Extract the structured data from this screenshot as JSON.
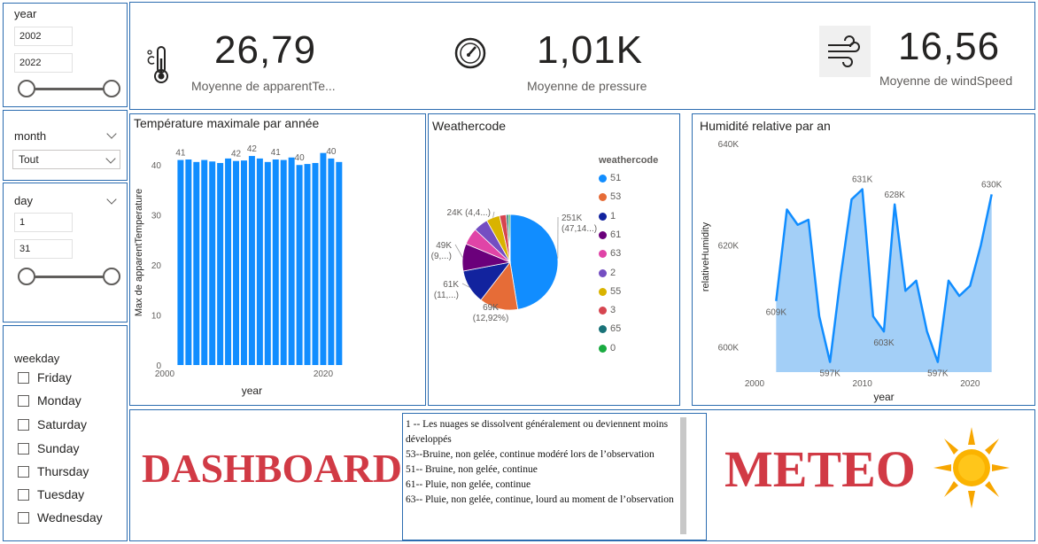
{
  "filters": {
    "year": {
      "label": "year",
      "from": "2002",
      "to": "2022"
    },
    "month": {
      "label": "month",
      "selected": "Tout"
    },
    "day": {
      "label": "day",
      "from": "1",
      "to": "31"
    },
    "weekday": {
      "label": "weekday",
      "options": [
        "Friday",
        "Monday",
        "Saturday",
        "Sunday",
        "Thursday",
        "Tuesday",
        "Wednesday"
      ]
    }
  },
  "kpis": [
    {
      "icon": "thermometer-icon",
      "value": "26,79",
      "label": "Moyenne de apparentTe..."
    },
    {
      "icon": "pressure-gauge-icon",
      "value": "1,01K",
      "label": "Moyenne de pressure"
    },
    {
      "icon": "wind-icon",
      "value": "16,56",
      "label": "Moyenne de windSpeed"
    }
  ],
  "cards": {
    "temp": {
      "title": "Température maximale par année"
    },
    "weather": {
      "title": "Weathercode"
    },
    "humidity": {
      "title": "Humidité relative par an"
    }
  },
  "chart_data": [
    {
      "type": "bar",
      "title": "Température maximale par année",
      "xlabel": "year",
      "ylabel": "Max de apparentTemperature",
      "categories": [
        2002,
        2003,
        2004,
        2005,
        2006,
        2007,
        2008,
        2009,
        2010,
        2011,
        2012,
        2013,
        2014,
        2015,
        2016,
        2017,
        2018,
        2019,
        2020,
        2021,
        2022
      ],
      "values": [
        41,
        41.1,
        40.6,
        41,
        40.7,
        40.4,
        41.3,
        40.8,
        40.9,
        41.8,
        41.3,
        40.6,
        41.1,
        41,
        41.5,
        40,
        40.2,
        40.4,
        42.4,
        41.3,
        40.6
      ],
      "data_labels": [
        {
          "x": 2002,
          "text": "41"
        },
        {
          "x": 2009,
          "text": "42"
        },
        {
          "x": 2011,
          "text": "42"
        },
        {
          "x": 2014,
          "text": "41"
        },
        {
          "x": 2017,
          "text": "40"
        },
        {
          "x": 2021,
          "text": "40"
        }
      ],
      "ylim": [
        0,
        45
      ],
      "yticks": [
        0,
        10,
        20,
        30,
        40
      ],
      "xticks": [
        2000,
        2020
      ],
      "color": "#118dff"
    },
    {
      "type": "pie",
      "title": "Weathercode",
      "legend_title": "weathercode",
      "legend_position": "right",
      "slices": [
        {
          "name": "51",
          "value": 251,
          "color": "#118dff",
          "label": [
            "251K",
            "(47,14...)"
          ]
        },
        {
          "name": "53",
          "value": 69,
          "color": "#e66c37",
          "label": [
            "69K",
            "(12,92%)"
          ]
        },
        {
          "name": "1",
          "value": 61,
          "color": "#12239e",
          "label": [
            "61K",
            "(11,...)"
          ]
        },
        {
          "name": "61",
          "value": 49,
          "color": "#6b007b",
          "label": [
            "49K",
            "(9,...)"
          ]
        },
        {
          "name": "63",
          "value": 30,
          "color": "#e044a7",
          "label": []
        },
        {
          "name": "2",
          "value": 26,
          "color": "#744ec2",
          "label": []
        },
        {
          "name": "55",
          "value": 24,
          "color": "#d9b300",
          "label": [
            "24K (4,4...)"
          ]
        },
        {
          "name": "3",
          "value": 12,
          "color": "#d64550",
          "label": []
        },
        {
          "name": "65",
          "value": 4,
          "color": "#197278",
          "label": []
        },
        {
          "name": "0",
          "value": 3,
          "color": "#1aab40",
          "label": []
        }
      ]
    },
    {
      "type": "area",
      "title": "Humidité relative par an",
      "xlabel": "year",
      "ylabel": "relativeHumidity",
      "x": [
        2002,
        2003,
        2004,
        2005,
        2006,
        2007,
        2008,
        2009,
        2010,
        2011,
        2012,
        2013,
        2014,
        2015,
        2016,
        2017,
        2018,
        2019,
        2020,
        2021,
        2022
      ],
      "values": [
        609,
        627,
        624,
        625,
        606,
        597,
        614,
        629,
        631,
        606,
        603,
        628,
        611,
        613,
        603,
        597,
        613,
        610,
        612,
        620,
        630
      ],
      "data_labels": [
        {
          "x": 2002,
          "text": "609K",
          "pos": "below"
        },
        {
          "x": 2007,
          "text": "597K",
          "pos": "below"
        },
        {
          "x": 2010,
          "text": "631K",
          "pos": "above"
        },
        {
          "x": 2012,
          "text": "603K",
          "pos": "below"
        },
        {
          "x": 2013,
          "text": "628K",
          "pos": "above"
        },
        {
          "x": 2017,
          "text": "597K",
          "pos": "below"
        },
        {
          "x": 2022,
          "text": "630K",
          "pos": "above"
        }
      ],
      "ylim": [
        595,
        640
      ],
      "yticks": [
        600,
        620,
        640
      ],
      "ytick_labels": [
        "600K",
        "620K",
        "640K"
      ],
      "xticks": [
        2000,
        2010,
        2020
      ],
      "line_color": "#118dff",
      "fill_color": "#a3cff7"
    }
  ],
  "notes": [
    "1 -- Les nuages se dissolvent généralement ou deviennent moins développés",
    "53--Bruine, non gelée, continue modéré lors de l’observation",
    "51-- Bruine, non gelée, continue",
    "61-- Pluie, non gelée, continue",
    "63-- Pluie, non gelée, continue, lourd au moment de l’observation"
  ],
  "banner": {
    "left": "DASHBOARD",
    "right": "METEO",
    "icon": "sun-icon"
  }
}
